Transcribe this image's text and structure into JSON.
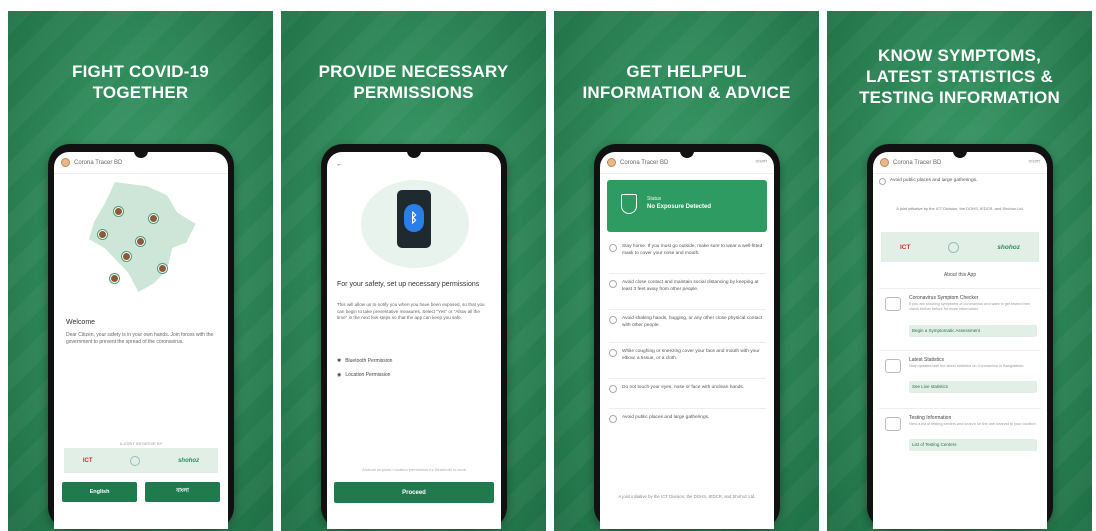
{
  "panels": [
    {
      "headline": "FIGHT COVID-19\nTOGETHER"
    },
    {
      "headline": "PROVIDE NECESSARY\nPERMISSIONS"
    },
    {
      "headline": "GET HELPFUL\nINFORMATION & ADVICE"
    },
    {
      "headline": "KNOW SYMPTOMS,\nLATEST STATISTICS &\nTESTING INFORMATION"
    }
  ],
  "app": {
    "title": "Corona Tracer BD",
    "menu": "বাংলা"
  },
  "screen1": {
    "welcome_title": "Welcome",
    "welcome_body": "Dear Citizen, your safety is in your own hands. Join forces with the government to prevent the spread of the coronavirus.",
    "sponsor_label": "A JOINT INITIATIVE BY",
    "sponsor_ict": "ICT",
    "sponsor_shohoz": "shohoz",
    "btn_english": "English",
    "btn_bangla": "বাংলা"
  },
  "screen2": {
    "back": "←",
    "title": "For your safety, set up necessary permissions",
    "body": "This will allow us to notify you when you have been exposed, so that you can begin to take preventative measures. Select \"Yes\" or \"Allow all the time\" in the next few steps so that the app can keep you safe.",
    "perm_bluetooth": "Bluetooth Permission",
    "perm_location": "Location Permission",
    "note": "Android requires Location permission for Bluetooth to work",
    "proceed": "Proceed"
  },
  "screen3": {
    "status_label": "Status",
    "status_value": "No Exposure Detected",
    "advice": [
      "Stay home. If you must go outside, make sure to wear a well-fitted mask to cover your nose and mouth.",
      "Avoid close contact and maintain social distancing by keeping at least 3 feet away from other people.",
      "Avoid shaking hands, hugging, or any other close physical contact with other people.",
      "While coughing or sneezing cover your face and mouth with your elbow, a tissue, or a cloth.",
      "Do not touch your eyes, nose or face with unclean hands.",
      "Avoid public places and large gatherings."
    ],
    "credit": "A joint initiative by the ICT Division, the DGHS, IEDCR, and Shohoz Ltd."
  },
  "screen4": {
    "top_item": "Avoid public places and large gatherings.",
    "credit": "A joint initiative by the ICT Division, the DGHS, IEDCR, and Shohoz Ltd.",
    "about": "About this App",
    "sections": [
      {
        "title": "Coronavirus Symptom Checker",
        "desc": "If you are showing symptoms of coronavirus and want to get tested then check further before for more information.",
        "link": "Begin a Symptomatic Assessment"
      },
      {
        "title": "Latest Statistics",
        "desc": "Stay updated with the latest statistics on Coronavirus in Bangladesh.",
        "link": "See Live statistics"
      },
      {
        "title": "Testing Information",
        "desc": "View a list of testing centers and search for the one nearest to your location.",
        "link": "List of Testing Centers"
      }
    ]
  },
  "colors": {
    "brand_green": "#1f7a4d",
    "panel_green": "#2f8a5a",
    "status_green": "#2e9b62"
  }
}
